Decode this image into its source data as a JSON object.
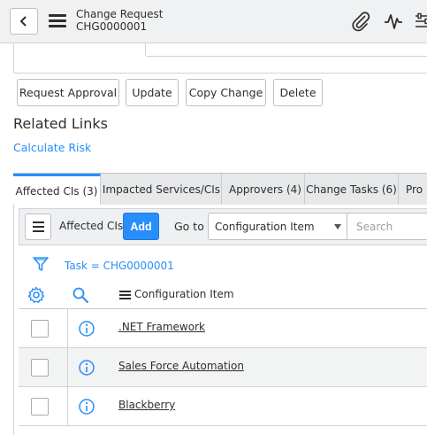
{
  "header": {
    "title": "Change Request",
    "number": "CHG0000001",
    "icons": [
      "back-icon",
      "hamburger-menu-icon",
      "paperclip-icon",
      "activity-icon",
      "settings-sliders-icon"
    ]
  },
  "actions": {
    "request_approval": "Request Approval",
    "update": "Update",
    "copy_change": "Copy Change",
    "delete": "Delete"
  },
  "related_links": {
    "title": "Related Links",
    "calculate_risk": "Calculate Risk"
  },
  "tabs": [
    {
      "label": "Affected CIs (3)",
      "active": true
    },
    {
      "label": "Impacted Services/CIs",
      "active": false
    },
    {
      "label": "Approvers (4)",
      "active": false
    },
    {
      "label": "Change Tasks (6)",
      "active": false
    },
    {
      "label": "Pro",
      "active": false
    }
  ],
  "list": {
    "label": "Affected CIs",
    "add_label": "Add",
    "goto_label": "Go to",
    "goto_selected": "Configuration Item",
    "search_placeholder": "Search",
    "filter_breadcrumb": "Task = CHG0000001",
    "column_header": "Configuration Item",
    "rows": [
      {
        "ci": ".NET Framework"
      },
      {
        "ci": "Sales Force Automation"
      },
      {
        "ci": "Blackberry"
      }
    ]
  },
  "colors": {
    "accent": "#278efc",
    "header_bg": "#f0f1f2",
    "tab_bg": "#e6e8ea"
  }
}
